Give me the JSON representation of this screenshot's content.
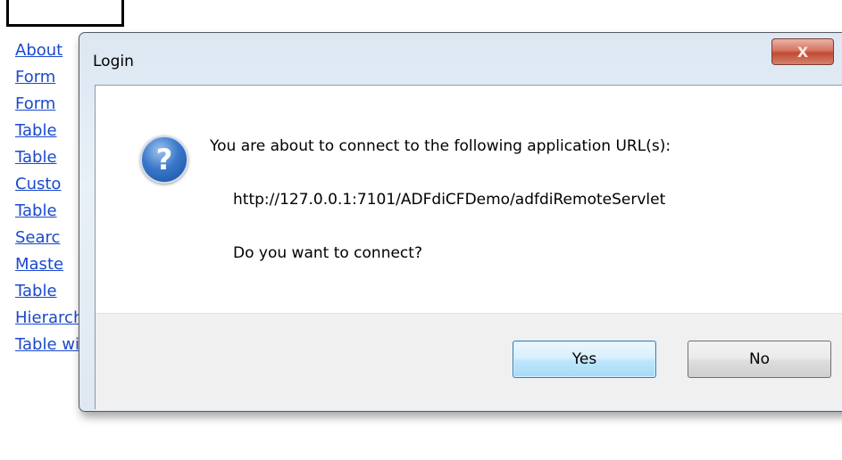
{
  "background": {
    "links": [
      "About",
      "Form",
      "Form",
      "Table",
      "Table",
      "Custo",
      "Table",
      "Searc",
      "Maste",
      "Table",
      "Hierarchical Table",
      "Table with Polymorphic VO"
    ]
  },
  "dialog": {
    "title": "Login",
    "close_label": "X",
    "icon": "question-icon",
    "message": "You are about to connect to the following application URL(s):",
    "url": "http://127.0.0.1:7101/ADFdiCFDemo/adfdiRemoteServlet",
    "question": "Do you want to connect?",
    "yes_label": "Yes",
    "no_label": "No"
  },
  "colors": {
    "link": "#1a49cc",
    "yes_button_border": "#3c7fb1",
    "close_button": "#c24a33"
  }
}
